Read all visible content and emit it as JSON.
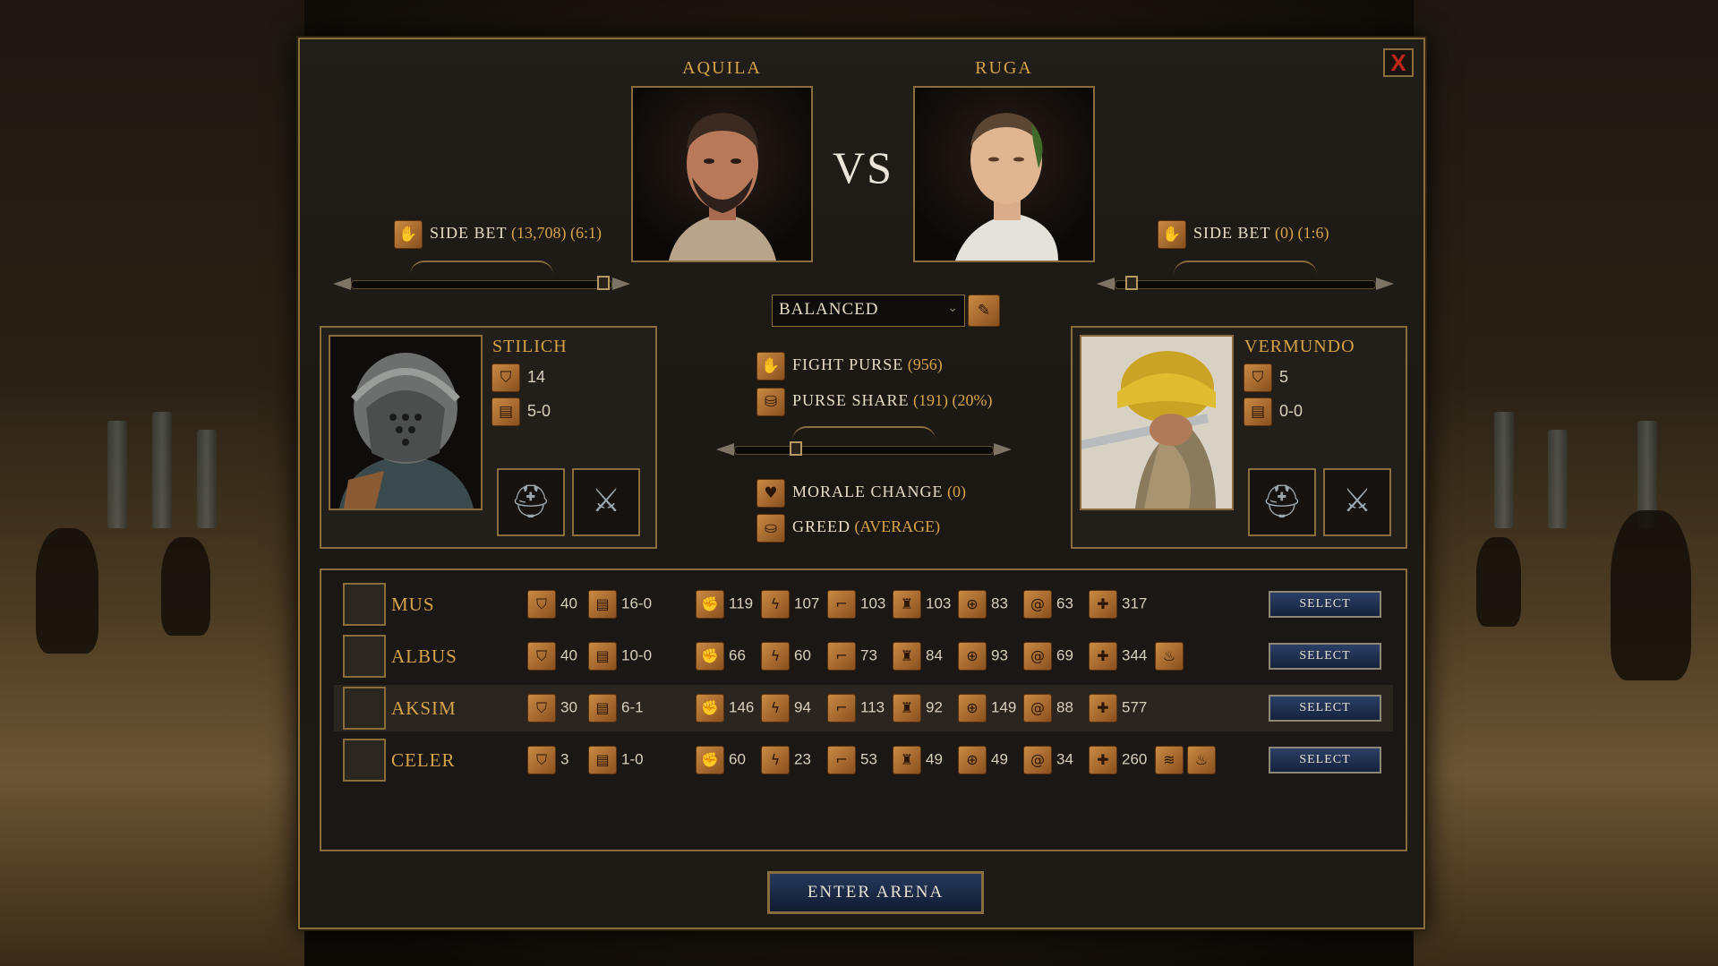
{
  "close_label": "X",
  "left_owner": {
    "name": "AQUILA",
    "side_bet_label": "SIDE BET",
    "side_bet_amount": "(13,708)",
    "side_bet_odds": "(6:1)"
  },
  "right_owner": {
    "name": "RUGA",
    "side_bet_label": "SIDE BET",
    "side_bet_amount": "(0)",
    "side_bet_odds": "(1:6)"
  },
  "vs_label": "VS",
  "stance": {
    "selected": "BALANCED"
  },
  "fight": {
    "purse_label": "FIGHT PURSE",
    "purse_value": "(956)",
    "share_label": "PURSE SHARE",
    "share_value": "(191)",
    "share_pct": "(20%)",
    "morale_label": "MORALE CHANGE",
    "morale_value": "(0)",
    "greed_label": "GREED",
    "greed_value": "(AVERAGE)"
  },
  "left_fighter": {
    "name": "STILICH",
    "level": "14",
    "record": "5-0"
  },
  "right_fighter": {
    "name": "VERMUNDO",
    "level": "5",
    "record": "0-0"
  },
  "roster": [
    {
      "name": "MUS",
      "level": "40",
      "record": "16-0",
      "stats": [
        "119",
        "107",
        "103",
        "103",
        "83",
        "63",
        "317"
      ],
      "traits": 0
    },
    {
      "name": "ALBUS",
      "level": "40",
      "record": "10-0",
      "stats": [
        "66",
        "60",
        "73",
        "84",
        "93",
        "69",
        "344"
      ],
      "traits": 1
    },
    {
      "name": "AKSIM",
      "level": "30",
      "record": "6-1",
      "stats": [
        "146",
        "94",
        "113",
        "92",
        "149",
        "88",
        "577"
      ],
      "traits": 0
    },
    {
      "name": "CELER",
      "level": "3",
      "record": "1-0",
      "stats": [
        "60",
        "23",
        "53",
        "49",
        "49",
        "34",
        "260"
      ],
      "traits": 2
    }
  ],
  "select_label": "SELECT",
  "enter_label": "ENTER ARENA",
  "icons": {
    "level": "helmet-level-icon",
    "record": "scroll-record-icon",
    "stats": [
      "fist-strength-icon",
      "lightning-agility-icon",
      "boot-speed-icon",
      "torso-constitution-icon",
      "target-accuracy-icon",
      "swirl-stamina-icon",
      "cross-health-icon"
    ]
  },
  "colors": {
    "gold": "#d6a349",
    "frame": "#8a6d3d",
    "select_blue": "#2b3f65",
    "close_red": "#c0261a"
  }
}
